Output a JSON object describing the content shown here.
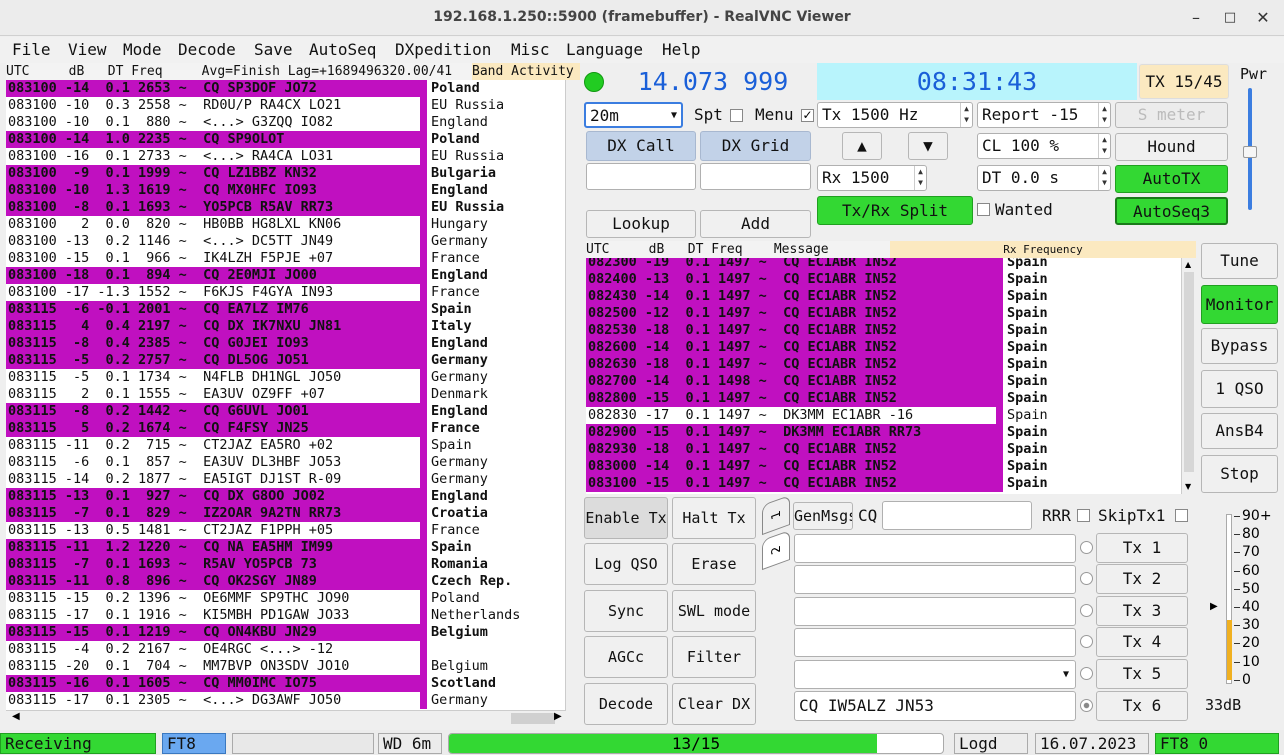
{
  "window": {
    "title": "192.168.1.250::5900 (framebuffer) - RealVNC Viewer"
  },
  "menu": [
    "File",
    "View",
    "Mode",
    "Decode",
    "Save",
    "AutoSeq",
    "DXpedition",
    "Misc",
    "Language",
    "Help"
  ],
  "band_activity": {
    "header": "UTC     dB   DT Freq     Avg=Finish Lag=+1689496320.00/41",
    "header_right": "Band Activity",
    "rows": [
      {
        "m": "083100 -14  0.1 2653 ~  CQ SP3DOF JO72",
        "c": "Poland",
        "h": true
      },
      {
        "m": "083100 -10  0.3 2558 ~  RD0U/P RA4CX LO21",
        "c": "EU Russia",
        "h": false
      },
      {
        "m": "083100 -10  0.1  880 ~  <...> G3ZQQ IO82",
        "c": "England",
        "h": false
      },
      {
        "m": "083100 -14  1.0 2235 ~  CQ SP9OLOT",
        "c": "Poland",
        "h": true
      },
      {
        "m": "083100 -16  0.1 2733 ~  <...> RA4CA LO31",
        "c": "EU Russia",
        "h": false
      },
      {
        "m": "083100  -9  0.1 1999 ~  CQ LZ1BBZ KN32",
        "c": "Bulgaria",
        "h": true
      },
      {
        "m": "083100 -10  1.3 1619 ~  CQ MX0HFC IO93",
        "c": "England",
        "h": true
      },
      {
        "m": "083100  -8  0.1 1693 ~  YO5PCB R5AV RR73",
        "c": "EU Russia",
        "h": true
      },
      {
        "m": "083100   2  0.0  820 ~  HB0BB HG8LXL KN06",
        "c": "Hungary",
        "h": false
      },
      {
        "m": "083100 -13  0.2 1146 ~  <...> DC5TT JN49",
        "c": "Germany",
        "h": false
      },
      {
        "m": "083100 -15  0.1  966 ~  IK4LZH F5PJE +07",
        "c": "France",
        "h": false
      },
      {
        "m": "083100 -18  0.1  894 ~  CQ 2E0MJI JO00",
        "c": "England",
        "h": true
      },
      {
        "m": "083100 -17 -1.3 1552 ~  F6KJS F4GYA IN93",
        "c": "France",
        "h": false
      },
      {
        "m": "083115  -6 -0.1 2001 ~  CQ EA7LZ IM76",
        "c": "Spain",
        "h": true
      },
      {
        "m": "083115   4  0.4 2197 ~  CQ DX IK7NXU JN81",
        "c": "Italy",
        "h": true
      },
      {
        "m": "083115  -8  0.4 2385 ~  CQ G0JEI IO93",
        "c": "England",
        "h": true
      },
      {
        "m": "083115  -5  0.2 2757 ~  CQ DL5OG JO51",
        "c": "Germany",
        "h": true
      },
      {
        "m": "083115  -5  0.1 1734 ~  N4FLB DH1NGL JO50",
        "c": "Germany",
        "h": false
      },
      {
        "m": "083115   2  0.1 1555 ~  EA3UV OZ9FF +07",
        "c": "Denmark",
        "h": false
      },
      {
        "m": "083115  -8  0.2 1442 ~  CQ G6UVL JO01",
        "c": "England",
        "h": true
      },
      {
        "m": "083115   5  0.2 1674 ~  CQ F4FSY JN25",
        "c": "France",
        "h": true
      },
      {
        "m": "083115 -11  0.2  715 ~  CT2JAZ EA5RO +02",
        "c": "Spain",
        "h": false
      },
      {
        "m": "083115  -6  0.1  857 ~  EA3UV DL3HBF JO53",
        "c": "Germany",
        "h": false
      },
      {
        "m": "083115 -14  0.2 1877 ~  EA5IGT DJ1ST R-09",
        "c": "Germany",
        "h": false
      },
      {
        "m": "083115 -13  0.1  927 ~  CQ DX G8OO JO02",
        "c": "England",
        "h": true
      },
      {
        "m": "083115  -7  0.1  829 ~  IZ2OAR 9A2TN RR73",
        "c": "Croatia",
        "h": true
      },
      {
        "m": "083115 -13  0.5 1481 ~  CT2JAZ F1PPH +05",
        "c": "France",
        "h": false
      },
      {
        "m": "083115 -11  1.2 1220 ~  CQ NA EA5HM IM99",
        "c": "Spain",
        "h": true
      },
      {
        "m": "083115  -7  0.1 1693 ~  R5AV YO5PCB 73",
        "c": "Romania",
        "h": true
      },
      {
        "m": "083115 -11  0.8  896 ~  CQ OK2SGY JN89",
        "c": "Czech Rep.",
        "h": true
      },
      {
        "m": "083115 -15  0.2 1396 ~  OE6MMF SP9THC JO90",
        "c": "Poland",
        "h": false
      },
      {
        "m": "083115 -17  0.1 1916 ~  KI5MBH PD1GAW JO33",
        "c": "Netherlands",
        "h": false
      },
      {
        "m": "083115 -15  0.1 1219 ~  CQ ON4KBU JN29",
        "c": "Belgium",
        "h": true
      },
      {
        "m": "083115  -4  0.2 2167 ~  OE4RGC <...> -12",
        "c": "",
        "h": false
      },
      {
        "m": "083115 -20  0.1  704 ~  MM7BVP ON3SDV JO10",
        "c": "Belgium",
        "h": false
      },
      {
        "m": "083115 -16  0.1 1605 ~  CQ MM0IMC IO75",
        "c": "Scotland",
        "h": true
      },
      {
        "m": "083115 -17  0.1 2305 ~  <...> DG3AWF JO50",
        "c": "Germany",
        "h": false
      }
    ]
  },
  "rx_frequency": {
    "header": "UTC     dB   DT Freq    Message",
    "header_right": "Rx Frequency",
    "rows": [
      {
        "m": "082300 -19  0.1 1497 ~  CQ EC1ABR IN52",
        "c": "Spain",
        "h": true
      },
      {
        "m": "082400 -13  0.1 1497 ~  CQ EC1ABR IN52",
        "c": "Spain",
        "h": true
      },
      {
        "m": "082430 -14  0.1 1497 ~  CQ EC1ABR IN52",
        "c": "Spain",
        "h": true
      },
      {
        "m": "082500 -12  0.1 1497 ~  CQ EC1ABR IN52",
        "c": "Spain",
        "h": true
      },
      {
        "m": "082530 -18  0.1 1497 ~  CQ EC1ABR IN52",
        "c": "Spain",
        "h": true
      },
      {
        "m": "082600 -14  0.1 1497 ~  CQ EC1ABR IN52",
        "c": "Spain",
        "h": true
      },
      {
        "m": "082630 -18  0.1 1497 ~  CQ EC1ABR IN52",
        "c": "Spain",
        "h": true
      },
      {
        "m": "082700 -14  0.1 1498 ~  CQ EC1ABR IN52",
        "c": "Spain",
        "h": true
      },
      {
        "m": "082800 -15  0.1 1497 ~  CQ EC1ABR IN52",
        "c": "Spain",
        "h": true
      },
      {
        "m": "082830 -17  0.1 1497 ~  DK3MM EC1ABR -16",
        "c": "Spain",
        "h": false
      },
      {
        "m": "082900 -15  0.1 1497 ~  DK3MM EC1ABR RR73",
        "c": "Spain",
        "h": true
      },
      {
        "m": "082930 -18  0.1 1497 ~  CQ EC1ABR IN52",
        "c": "Spain",
        "h": true
      },
      {
        "m": "083000 -14  0.1 1497 ~  CQ EC1ABR IN52",
        "c": "Spain",
        "h": true
      },
      {
        "m": "083100 -15  0.1 1497 ~  CQ EC1ABR IN52",
        "c": "Spain",
        "h": true
      }
    ]
  },
  "dial_freq": "14.073 999",
  "clock": "08:31:43",
  "tx_counter": "TX 15/45",
  "pwr_label": "Pwr",
  "band": "20m",
  "spt_label": "Spt",
  "menu_label": "Menu",
  "tx_hz": "Tx  1500  Hz",
  "rx_hz": "Rx  1500",
  "report": "Report -15",
  "s_meter": "S meter",
  "cl": "CL  100 %",
  "dt": "DT 0.0 s",
  "buttons": {
    "dx_call": "DX Call",
    "dx_grid": "DX Grid",
    "lookup": "Lookup",
    "add": "Add",
    "hound": "Hound",
    "autotx": "AutoTX",
    "txrx_split": "Tx/Rx Split",
    "wanted": "Wanted",
    "autoseq3": "AutoSeq3",
    "up": "▲",
    "down": "▼",
    "tune": "Tune",
    "monitor": "Monitor",
    "bypass": "Bypass",
    "one_qso": "1 QSO",
    "ansb4": "AnsB4",
    "stop": "Stop",
    "enable_tx": "Enable Tx",
    "halt_tx": "Halt Tx",
    "log_qso": "Log QSO",
    "erase": "Erase",
    "sync": "Sync",
    "swl_mode": "SWL mode",
    "agcc": "AGCc",
    "filter": "Filter",
    "decode": "Decode",
    "clear_dx": "Clear DX",
    "genmsgs": "GenMsgs",
    "cq": "CQ",
    "rrr": "RRR",
    "skiptx1": "SkipTx1",
    "tab1": "1",
    "tab2": "2"
  },
  "tx_messages": [
    "",
    "",
    "",
    "",
    "",
    "CQ IW5ALZ JN53"
  ],
  "tx_labels": [
    "Tx 1",
    "Tx 2",
    "Tx 3",
    "Tx 4",
    "Tx 5",
    "Tx 6"
  ],
  "meter": {
    "ticks": [
      "90+",
      "80",
      "70",
      "60",
      "50",
      "40",
      "30",
      "20",
      "10",
      "0"
    ],
    "level_db": "33dB",
    "level_value": 33
  },
  "status": {
    "receiving": "Receiving",
    "mode": "FT8",
    "wd": "WD 6m",
    "progress": "13/15",
    "progress_fraction": 0.8667,
    "logd": "Logd",
    "date": "16.07.2023",
    "mode_count": "FT8   0"
  },
  "colors": {
    "highlight": "#c010c0",
    "green": "#33d833",
    "cyan": "#b8f4fc"
  }
}
